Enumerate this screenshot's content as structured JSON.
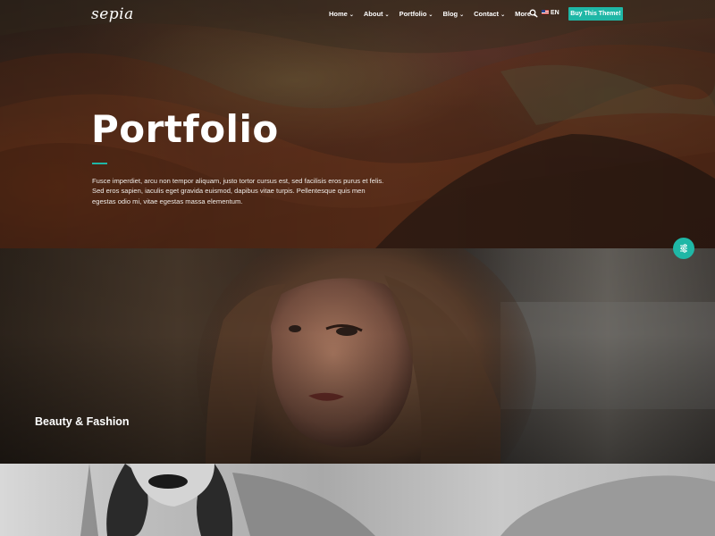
{
  "brand": {
    "logo_text": "sepia"
  },
  "nav": {
    "items": [
      {
        "label": "Home",
        "has_dropdown": true
      },
      {
        "label": "About",
        "has_dropdown": true
      },
      {
        "label": "Portfolio",
        "has_dropdown": true
      },
      {
        "label": "Blog",
        "has_dropdown": true
      },
      {
        "label": "Contact",
        "has_dropdown": true
      },
      {
        "label": "More",
        "has_dropdown": true
      }
    ],
    "search_icon": "search-icon",
    "language": "EN",
    "cta_label": "Buy This Theme!"
  },
  "hero": {
    "title": "Portfolio",
    "description": "Fusce imperdiet, arcu non tempor aliquam, justo tortor cursus est, sed facilisis eros purus et felis. Sed eros sapien, iaculis eget gravida euismod, dapibus vitae turpis. Pellentesque quis men egestas odio mi, vitae egestas massa elementum."
  },
  "filter_button": {
    "icon": "sliders-icon"
  },
  "portfolio_items": [
    {
      "title": "Beauty & Fashion"
    },
    {
      "title": ""
    }
  ],
  "colors": {
    "accent": "#1fb7a6",
    "text_light": "#ffffff"
  }
}
